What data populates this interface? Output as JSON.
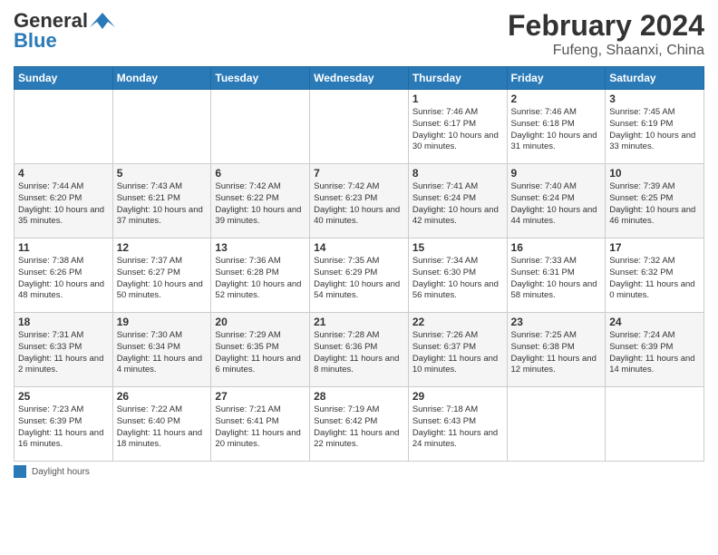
{
  "header": {
    "logo_general": "General",
    "logo_blue": "Blue",
    "month_year": "February 2024",
    "location": "Fufeng, Shaanxi, China"
  },
  "weekdays": [
    "Sunday",
    "Monday",
    "Tuesday",
    "Wednesday",
    "Thursday",
    "Friday",
    "Saturday"
  ],
  "weeks": [
    [
      {
        "day": "",
        "info": ""
      },
      {
        "day": "",
        "info": ""
      },
      {
        "day": "",
        "info": ""
      },
      {
        "day": "",
        "info": ""
      },
      {
        "day": "1",
        "info": "Sunrise: 7:46 AM\nSunset: 6:17 PM\nDaylight: 10 hours\nand 30 minutes."
      },
      {
        "day": "2",
        "info": "Sunrise: 7:46 AM\nSunset: 6:18 PM\nDaylight: 10 hours\nand 31 minutes."
      },
      {
        "day": "3",
        "info": "Sunrise: 7:45 AM\nSunset: 6:19 PM\nDaylight: 10 hours\nand 33 minutes."
      }
    ],
    [
      {
        "day": "4",
        "info": "Sunrise: 7:44 AM\nSunset: 6:20 PM\nDaylight: 10 hours\nand 35 minutes."
      },
      {
        "day": "5",
        "info": "Sunrise: 7:43 AM\nSunset: 6:21 PM\nDaylight: 10 hours\nand 37 minutes."
      },
      {
        "day": "6",
        "info": "Sunrise: 7:42 AM\nSunset: 6:22 PM\nDaylight: 10 hours\nand 39 minutes."
      },
      {
        "day": "7",
        "info": "Sunrise: 7:42 AM\nSunset: 6:23 PM\nDaylight: 10 hours\nand 40 minutes."
      },
      {
        "day": "8",
        "info": "Sunrise: 7:41 AM\nSunset: 6:24 PM\nDaylight: 10 hours\nand 42 minutes."
      },
      {
        "day": "9",
        "info": "Sunrise: 7:40 AM\nSunset: 6:24 PM\nDaylight: 10 hours\nand 44 minutes."
      },
      {
        "day": "10",
        "info": "Sunrise: 7:39 AM\nSunset: 6:25 PM\nDaylight: 10 hours\nand 46 minutes."
      }
    ],
    [
      {
        "day": "11",
        "info": "Sunrise: 7:38 AM\nSunset: 6:26 PM\nDaylight: 10 hours\nand 48 minutes."
      },
      {
        "day": "12",
        "info": "Sunrise: 7:37 AM\nSunset: 6:27 PM\nDaylight: 10 hours\nand 50 minutes."
      },
      {
        "day": "13",
        "info": "Sunrise: 7:36 AM\nSunset: 6:28 PM\nDaylight: 10 hours\nand 52 minutes."
      },
      {
        "day": "14",
        "info": "Sunrise: 7:35 AM\nSunset: 6:29 PM\nDaylight: 10 hours\nand 54 minutes."
      },
      {
        "day": "15",
        "info": "Sunrise: 7:34 AM\nSunset: 6:30 PM\nDaylight: 10 hours\nand 56 minutes."
      },
      {
        "day": "16",
        "info": "Sunrise: 7:33 AM\nSunset: 6:31 PM\nDaylight: 10 hours\nand 58 minutes."
      },
      {
        "day": "17",
        "info": "Sunrise: 7:32 AM\nSunset: 6:32 PM\nDaylight: 11 hours\nand 0 minutes."
      }
    ],
    [
      {
        "day": "18",
        "info": "Sunrise: 7:31 AM\nSunset: 6:33 PM\nDaylight: 11 hours\nand 2 minutes."
      },
      {
        "day": "19",
        "info": "Sunrise: 7:30 AM\nSunset: 6:34 PM\nDaylight: 11 hours\nand 4 minutes."
      },
      {
        "day": "20",
        "info": "Sunrise: 7:29 AM\nSunset: 6:35 PM\nDaylight: 11 hours\nand 6 minutes."
      },
      {
        "day": "21",
        "info": "Sunrise: 7:28 AM\nSunset: 6:36 PM\nDaylight: 11 hours\nand 8 minutes."
      },
      {
        "day": "22",
        "info": "Sunrise: 7:26 AM\nSunset: 6:37 PM\nDaylight: 11 hours\nand 10 minutes."
      },
      {
        "day": "23",
        "info": "Sunrise: 7:25 AM\nSunset: 6:38 PM\nDaylight: 11 hours\nand 12 minutes."
      },
      {
        "day": "24",
        "info": "Sunrise: 7:24 AM\nSunset: 6:39 PM\nDaylight: 11 hours\nand 14 minutes."
      }
    ],
    [
      {
        "day": "25",
        "info": "Sunrise: 7:23 AM\nSunset: 6:39 PM\nDaylight: 11 hours\nand 16 minutes."
      },
      {
        "day": "26",
        "info": "Sunrise: 7:22 AM\nSunset: 6:40 PM\nDaylight: 11 hours\nand 18 minutes."
      },
      {
        "day": "27",
        "info": "Sunrise: 7:21 AM\nSunset: 6:41 PM\nDaylight: 11 hours\nand 20 minutes."
      },
      {
        "day": "28",
        "info": "Sunrise: 7:19 AM\nSunset: 6:42 PM\nDaylight: 11 hours\nand 22 minutes."
      },
      {
        "day": "29",
        "info": "Sunrise: 7:18 AM\nSunset: 6:43 PM\nDaylight: 11 hours\nand 24 minutes."
      },
      {
        "day": "",
        "info": ""
      },
      {
        "day": "",
        "info": ""
      }
    ]
  ],
  "footer": {
    "legend_label": "Daylight hours"
  }
}
